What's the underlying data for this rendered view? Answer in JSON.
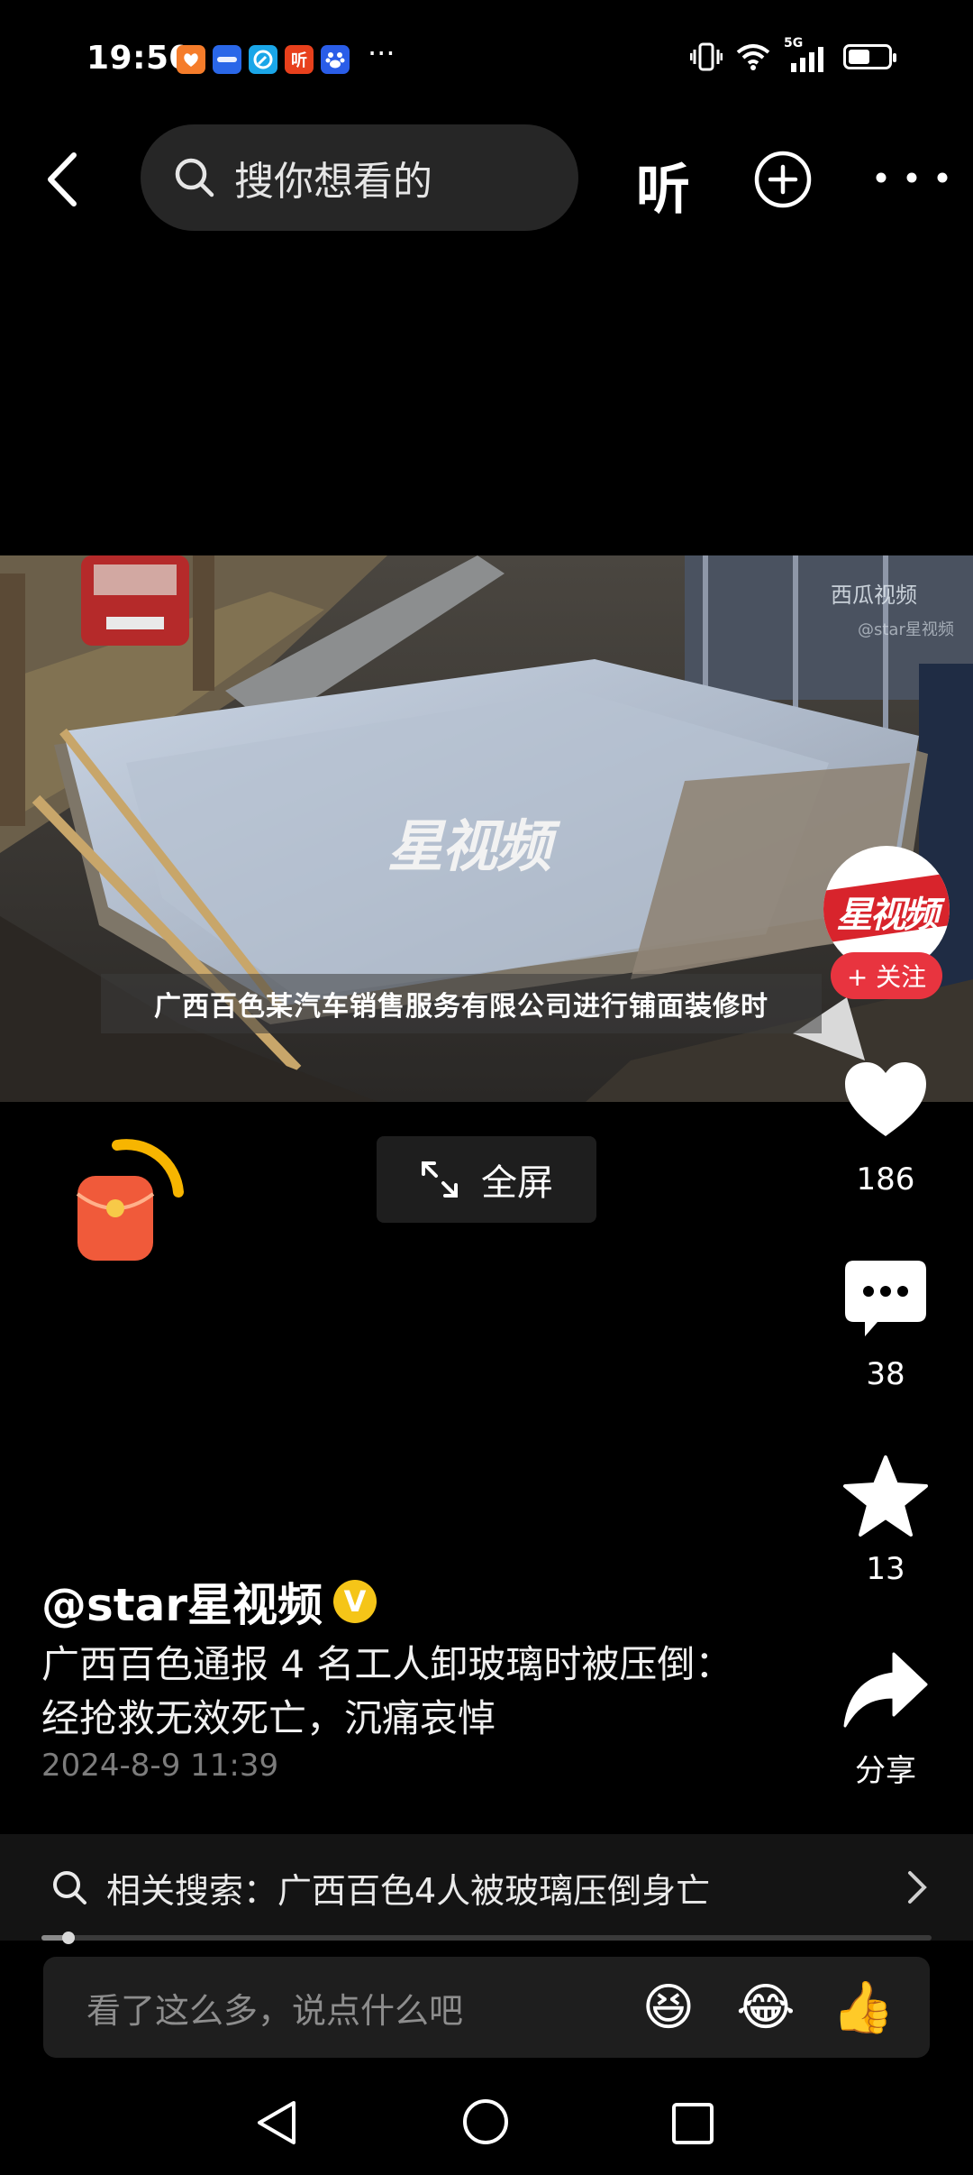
{
  "status_bar": {
    "time": "19:50",
    "apps": [
      {
        "icon": "orange-app-icon",
        "label": "",
        "color": "#f57c2a"
      },
      {
        "icon": "blue-app-icon",
        "label": "",
        "color": "#2a67e8"
      },
      {
        "icon": "browser-app-icon",
        "label": "",
        "color": "#1aa6e8"
      },
      {
        "icon": "ting-app-icon",
        "label": "听",
        "color": "#e8401c"
      },
      {
        "icon": "baidu-app-icon",
        "label": "",
        "color": "#2a5de8"
      }
    ],
    "more": "···",
    "network": "5G",
    "battery_level": 0.55
  },
  "top_bar": {
    "search_placeholder": "搜你想看的",
    "listen_label": "听"
  },
  "video": {
    "watermark": "西瓜视频",
    "watermark_sub": "@star星视频",
    "center_logo": "星视频",
    "subtitle": "广西百色某汽车销售服务有限公司进行铺面装修时",
    "fullscreen_label": "全屏"
  },
  "side_rail": {
    "avatar_text": "星视频",
    "follow_label": "+ 关注",
    "like_count": "186",
    "comment_count": "38",
    "favorite_count": "13",
    "share_label": "分享"
  },
  "post": {
    "author": "@star星视频",
    "verified_mark": "V",
    "caption_line1": "广西百色通报 4 名工人卸玻璃时被压倒：",
    "caption_line2": "经抢救无效死亡，沉痛哀悼",
    "date": "2024-8-9 11:39"
  },
  "related_search": {
    "text": "相关搜索：广西百色4人被玻璃压倒身亡"
  },
  "progress": {
    "played_fraction": 0.03
  },
  "comment_bar": {
    "placeholder": "看了这么多，说点什么吧",
    "emojis": [
      "😆",
      "😂",
      "👍"
    ]
  },
  "colors": {
    "accent_red": "#e8343f",
    "verified_gold": "#f5c518"
  }
}
